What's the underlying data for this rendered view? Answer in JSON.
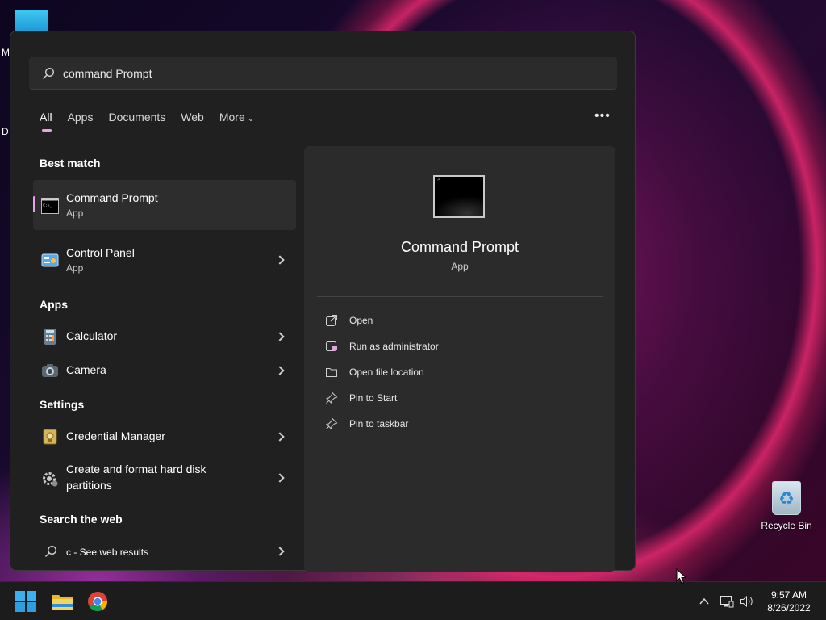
{
  "desktop": {
    "edge_letter_1": "M",
    "edge_letter_2": "D",
    "recycle_bin_label": "Recycle Bin"
  },
  "search": {
    "query": "command Prompt"
  },
  "tabs": [
    {
      "label": "All"
    },
    {
      "label": "Apps"
    },
    {
      "label": "Documents"
    },
    {
      "label": "Web"
    },
    {
      "label": "More"
    }
  ],
  "options_label": "•••",
  "sections": {
    "best_match": "Best match",
    "apps": "Apps",
    "settings": "Settings",
    "search_web": "Search the web"
  },
  "results": {
    "best": {
      "title": "Command Prompt",
      "sub": "App"
    },
    "control_panel": {
      "title": "Control Panel",
      "sub": "App"
    },
    "calculator": {
      "title": "Calculator"
    },
    "camera": {
      "title": "Camera"
    },
    "credential_manager": {
      "title": "Credential Manager"
    },
    "disk": {
      "title": "Create and format hard disk partitions",
      "line1": "Create and format hard disk",
      "line2": "partitions"
    },
    "web": {
      "title": "c - See web results"
    }
  },
  "preview": {
    "name": "Command Prompt",
    "type": "App",
    "actions": [
      {
        "label": "Open",
        "icon": "open-external-icon"
      },
      {
        "label": "Run as administrator",
        "icon": "shield-admin-icon"
      },
      {
        "label": "Open file location",
        "icon": "folder-icon"
      },
      {
        "label": "Pin to Start",
        "icon": "pin-icon"
      },
      {
        "label": "Pin to taskbar",
        "icon": "pin-icon"
      }
    ]
  },
  "taskbar": {
    "time": "9:57 AM",
    "date": "8/26/2022"
  },
  "colors": {
    "accent": "#e8a1e9",
    "panel_bg": "#202020",
    "preview_bg": "#2b2b2b"
  }
}
